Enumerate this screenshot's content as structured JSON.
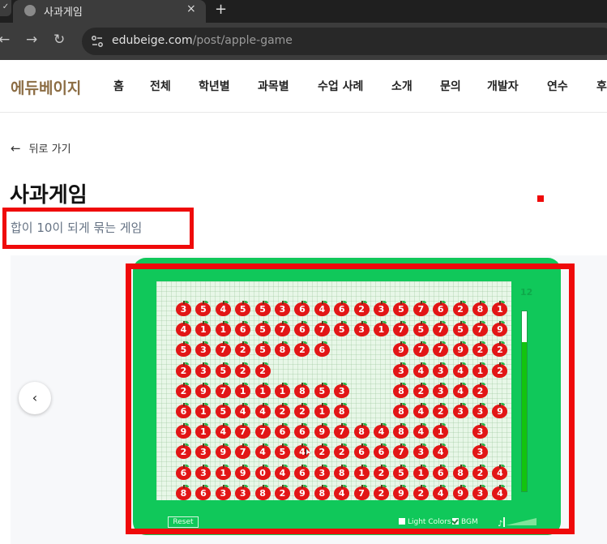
{
  "browser": {
    "tab_title": "사과게임",
    "tab_close": "×",
    "new_tab": "+",
    "url_domain": "edubeige.com",
    "url_path": "/post/apple-game",
    "back_icon": "←",
    "forward_icon": "→",
    "reload_icon": "↻"
  },
  "header": {
    "logo": "에듀베이지",
    "menu": [
      "홈",
      "전체",
      "학년별",
      "과목별",
      "수업 사례",
      "소개",
      "문의",
      "개발자",
      "연수",
      "후"
    ]
  },
  "page": {
    "back_label": "뒤로 가기",
    "title": "사과게임",
    "subtitle": "합이 10이 되게 묶는 게임",
    "carousel_prev": "‹"
  },
  "game": {
    "score": "12",
    "timer_fraction": 0.83,
    "reset_label": "Reset",
    "light_colors_label": "Light Colors",
    "light_colors_checked": false,
    "bgm_label": "BGM",
    "bgm_checked": true,
    "apple_color": "#e21616",
    "grid": [
      "35455364623576281",
      "41165767531757579",
      "53725826   977922",
      "23522      343412",
      "297111853  82342",
      "615442218  842339",
      "91477669784841 3",
      "23974542266734 3",
      "63190463812516824",
      "86338298472924934"
    ]
  }
}
